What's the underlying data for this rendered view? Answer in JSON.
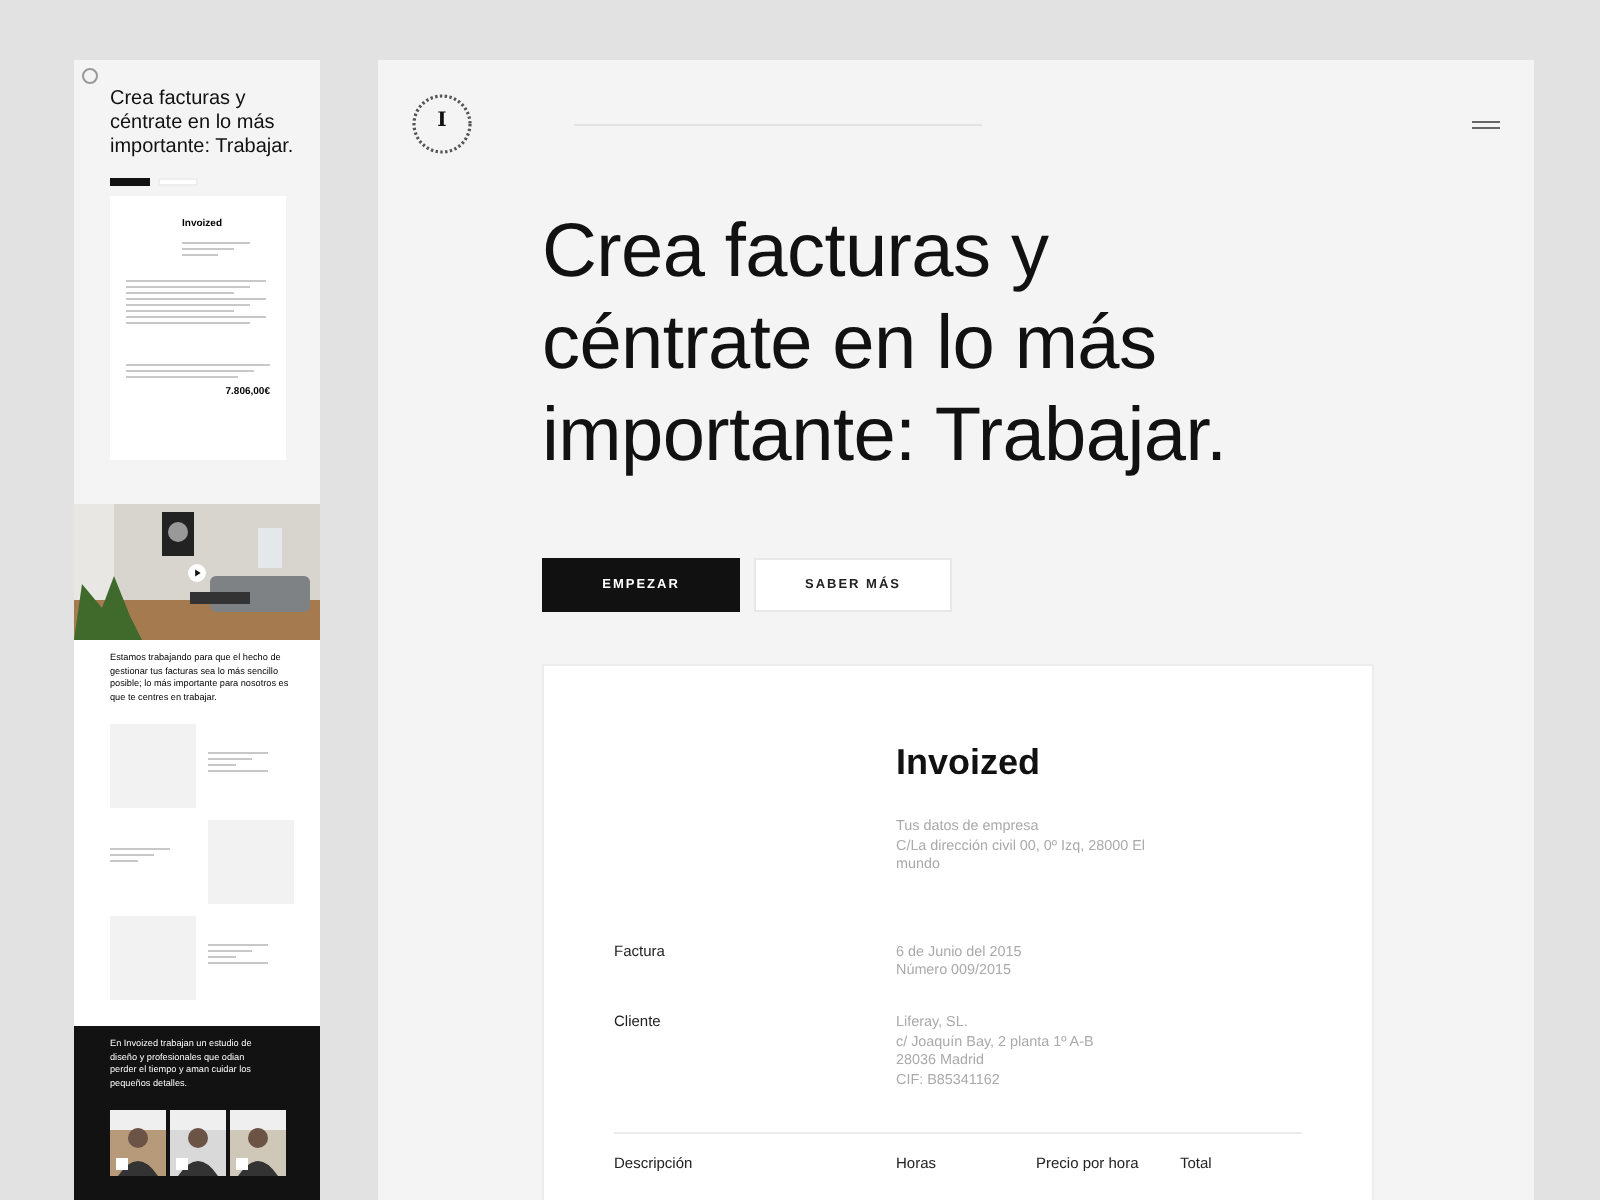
{
  "thumbnail": {
    "headline": "Crea facturas y céntrate en lo más importante: Trabajar.",
    "invoice_title": "Invoized",
    "invoice_total": "7.806,00€",
    "intro": "Estamos trabajando para que el hecho de gestionar tus facturas sea lo más sencillo posible; lo más importante para nosotros es que te centres en trabajar.",
    "studio_text": "En Invoized trabajan un estudio de diseño y profesionales que odian perder el tiempo y aman cuidar los pequeños detalles."
  },
  "header": {
    "logo_letter": "I"
  },
  "hero": {
    "headline": "Crea facturas y céntrate en lo más importante: Trabajar.",
    "buttons": [
      {
        "label": "EMPEZAR",
        "kind": "primary"
      },
      {
        "label": "SABER MÁS",
        "kind": "secondary"
      }
    ]
  },
  "invoice": {
    "title": "Invoized",
    "company_lines": [
      "Tus datos de empresa",
      "C/La dirección civil 00, 0º Izq, 28000 El mundo"
    ],
    "fields": [
      {
        "label": "Factura",
        "lines": [
          "6 de Junio del 2015",
          "Número 009/2015"
        ]
      },
      {
        "label": "Cliente",
        "lines": [
          "Liferay, SL.",
          "c/ Joaquín Bay, 2 planta 1º A-B",
          "28036  Madrid",
          "CIF: B85341162"
        ]
      }
    ],
    "columns": [
      "Descripción",
      "Horas",
      "Precio por hora",
      "Total"
    ]
  }
}
